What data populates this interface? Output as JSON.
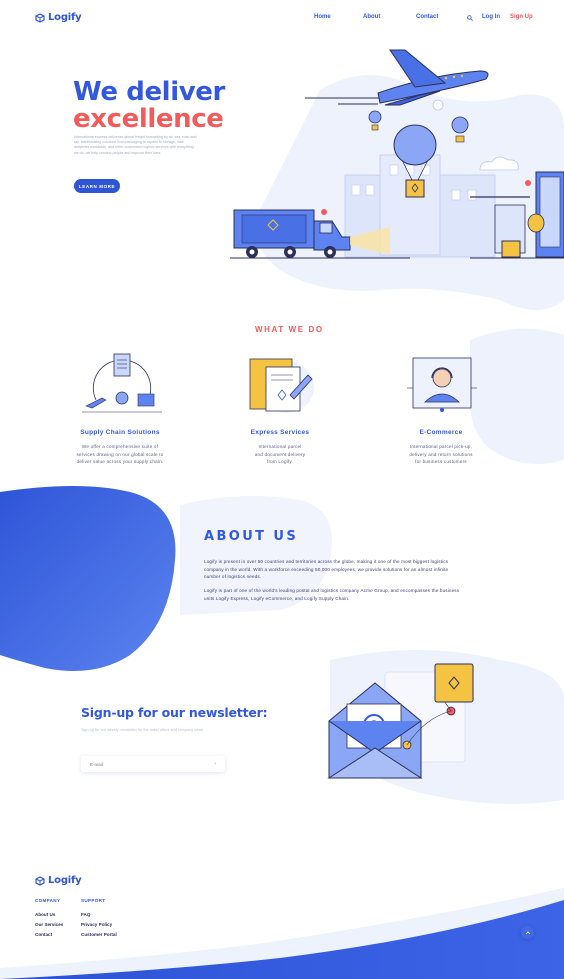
{
  "header": {
    "logo_text": "Logify",
    "nav": [
      "Home",
      "About",
      "Contact"
    ],
    "login": "Log In",
    "signup": "Sign Up"
  },
  "hero": {
    "title_line1": "We deliver",
    "title_line2": "excellence",
    "description": "International express deliveries global freight forwarding by air, sea, road and rail, warehousing solutions from packaging to repairs to storage, mail deliveries worldwide, and other customized logistic services with everything we do, we help connect people and improve their lives.",
    "cta": "LEARN MORE"
  },
  "what_we_do": {
    "label": "WHAT WE DO",
    "services": [
      {
        "title": "Supply Chain Solutions",
        "text": [
          "We offer a comprehensive suite of",
          "services drawing on our global scale to",
          "deliver value across your supply chain."
        ]
      },
      {
        "title": "Express Services",
        "text": [
          "International parcel",
          "and document delivery",
          "from Logify."
        ]
      },
      {
        "title": "E-Commerce",
        "text": [
          "International parcel pick-up,",
          "delivery and return solutions",
          "for business customers"
        ]
      }
    ]
  },
  "about": {
    "title": "ABOUT US",
    "p1": "Logify is present in over 50 countries and territories across the globe, making it one of  the most biggest logistics company in the world. With a workforce exceeding 50,000 employees, we provide solutions for an almost infinite number of logistics needs.",
    "p2": "Logify is part of one of the world's leading postal and logistics company Acme Group,  and encompasses the business units Logify Express, Logify eCommerce, and Logify Supply Chain."
  },
  "newsletter": {
    "title": "Sign-up for our newsletter:",
    "subtitle": "Sign up for our weekly newsletter for the latest offers and company news.",
    "email_placeholder": "E-mail",
    "submit_icon": "arrow-right-icon"
  },
  "footer": {
    "logo_text": "Logify",
    "columns": [
      {
        "heading": "COMPANY",
        "links": [
          "About Us",
          "Our Services",
          "Contact"
        ]
      },
      {
        "heading": "SUPPORT",
        "links": [
          "FAQ",
          "Privacy Policy",
          "Customer Portal"
        ]
      }
    ]
  },
  "colors": {
    "primary": "#3358e0",
    "accent": "#f35b5b",
    "light_blob": "#eef2fd",
    "dark_blue": "#2e55d6",
    "yellow": "#f5c342"
  }
}
